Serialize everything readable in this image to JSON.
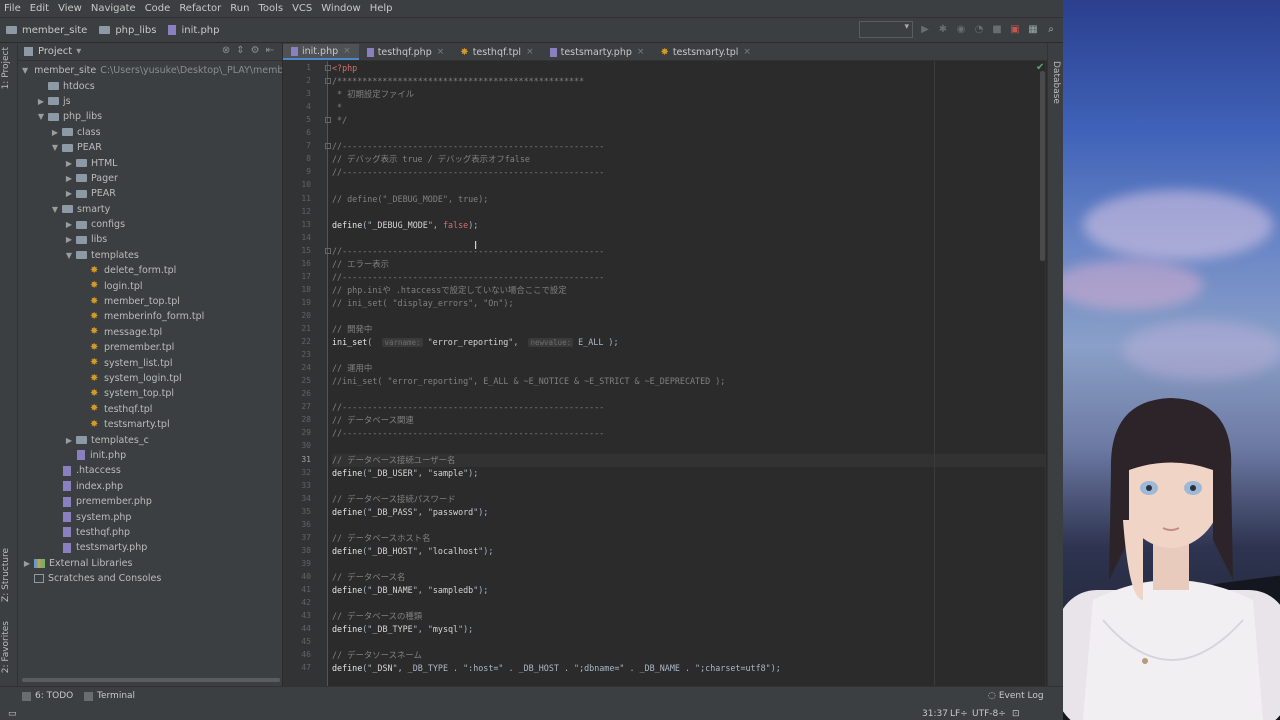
{
  "menu": [
    "File",
    "Edit",
    "View",
    "Navigate",
    "Code",
    "Refactor",
    "Run",
    "Tools",
    "VCS",
    "Window",
    "Help"
  ],
  "breadcrumbs": [
    "member_site",
    "php_libs",
    "init.php"
  ],
  "left_strip": {
    "project": "1: Project",
    "structure": "Z: Structure",
    "favorites": "2: Favorites"
  },
  "right_strip": {
    "database": "Database"
  },
  "project_panel": {
    "title": "Project",
    "root_path": "C:\\Users\\yusuke\\Desktop\\_PLAY\\member_s",
    "tree": [
      {
        "label": "member_site",
        "depth": 0,
        "type": "folder",
        "open": true
      },
      {
        "label": "htdocs",
        "depth": 1,
        "type": "folder",
        "open": false,
        "noarrow": true
      },
      {
        "label": "js",
        "depth": 1,
        "type": "folder",
        "open": false
      },
      {
        "label": "php_libs",
        "depth": 1,
        "type": "folder",
        "open": true
      },
      {
        "label": "class",
        "depth": 2,
        "type": "folder",
        "open": false
      },
      {
        "label": "PEAR",
        "depth": 2,
        "type": "folder",
        "open": true
      },
      {
        "label": "HTML",
        "depth": 3,
        "type": "folder",
        "open": false
      },
      {
        "label": "Pager",
        "depth": 3,
        "type": "folder",
        "open": false
      },
      {
        "label": "PEAR",
        "depth": 3,
        "type": "folder",
        "open": false
      },
      {
        "label": "smarty",
        "depth": 2,
        "type": "folder",
        "open": true
      },
      {
        "label": "configs",
        "depth": 3,
        "type": "folder",
        "open": false
      },
      {
        "label": "libs",
        "depth": 3,
        "type": "folder",
        "open": false
      },
      {
        "label": "templates",
        "depth": 3,
        "type": "folder",
        "open": true
      },
      {
        "label": "delete_form.tpl",
        "depth": 4,
        "type": "tpl"
      },
      {
        "label": "login.tpl",
        "depth": 4,
        "type": "tpl"
      },
      {
        "label": "member_top.tpl",
        "depth": 4,
        "type": "tpl"
      },
      {
        "label": "memberinfo_form.tpl",
        "depth": 4,
        "type": "tpl"
      },
      {
        "label": "message.tpl",
        "depth": 4,
        "type": "tpl"
      },
      {
        "label": "premember.tpl",
        "depth": 4,
        "type": "tpl"
      },
      {
        "label": "system_list.tpl",
        "depth": 4,
        "type": "tpl"
      },
      {
        "label": "system_login.tpl",
        "depth": 4,
        "type": "tpl"
      },
      {
        "label": "system_top.tpl",
        "depth": 4,
        "type": "tpl"
      },
      {
        "label": "testhqf.tpl",
        "depth": 4,
        "type": "tpl"
      },
      {
        "label": "testsmarty.tpl",
        "depth": 4,
        "type": "tpl"
      },
      {
        "label": "templates_c",
        "depth": 3,
        "type": "folder",
        "open": false
      },
      {
        "label": "init.php",
        "depth": 3,
        "type": "php"
      },
      {
        "label": ".htaccess",
        "depth": 2,
        "type": "php"
      },
      {
        "label": "index.php",
        "depth": 2,
        "type": "php"
      },
      {
        "label": "premember.php",
        "depth": 2,
        "type": "php"
      },
      {
        "label": "system.php",
        "depth": 2,
        "type": "php"
      },
      {
        "label": "testhqf.php",
        "depth": 2,
        "type": "php"
      },
      {
        "label": "testsmarty.php",
        "depth": 2,
        "type": "php"
      },
      {
        "label": "External Libraries",
        "depth": 0,
        "type": "lib"
      },
      {
        "label": "Scratches and Consoles",
        "depth": 0,
        "type": "cons"
      }
    ]
  },
  "tabs": [
    {
      "label": "init.php",
      "kind": "php",
      "active": true
    },
    {
      "label": "testhqf.php",
      "kind": "php",
      "active": false
    },
    {
      "label": "testhqf.tpl",
      "kind": "tpl",
      "active": false
    },
    {
      "label": "testsmarty.php",
      "kind": "php",
      "active": false
    },
    {
      "label": "testsmarty.tpl",
      "kind": "tpl",
      "active": false
    }
  ],
  "editor": {
    "current_line": 31,
    "lines": [
      {
        "n": 1,
        "segs": [
          [
            "ff",
            "<?php"
          ]
        ]
      },
      {
        "n": 2,
        "segs": [
          [
            "cmt",
            "/*************************************************"
          ]
        ]
      },
      {
        "n": 3,
        "segs": [
          [
            "cmt",
            " * 初期設定ファイル"
          ]
        ]
      },
      {
        "n": 4,
        "segs": [
          [
            "cmt",
            " *"
          ]
        ]
      },
      {
        "n": 5,
        "segs": [
          [
            "cmt",
            " */"
          ]
        ]
      },
      {
        "n": 6,
        "segs": []
      },
      {
        "n": 7,
        "segs": [
          [
            "cmt",
            "//----------------------------------------------------"
          ]
        ]
      },
      {
        "n": 8,
        "segs": [
          [
            "cmt",
            "// デバッグ表示 true / デバッグ表示オフfalse"
          ]
        ]
      },
      {
        "n": 9,
        "segs": [
          [
            "cmt",
            "//----------------------------------------------------"
          ]
        ]
      },
      {
        "n": 10,
        "segs": []
      },
      {
        "n": 11,
        "segs": [
          [
            "cmt",
            "// define(\"_DEBUG_MODE\", true);"
          ]
        ]
      },
      {
        "n": 12,
        "segs": []
      },
      {
        "n": 13,
        "segs": [
          [
            "fn",
            "define"
          ],
          [
            "",
            "(\""
          ],
          [
            "str",
            "_DEBUG_MODE"
          ],
          [
            "",
            "\", "
          ],
          [
            "ff",
            "false"
          ],
          [
            "",
            ");"
          ]
        ]
      },
      {
        "n": 14,
        "segs": []
      },
      {
        "n": 15,
        "segs": [
          [
            "cmt",
            "//----------------------------------------------------"
          ]
        ]
      },
      {
        "n": 16,
        "segs": [
          [
            "cmt",
            "// エラー表示"
          ]
        ]
      },
      {
        "n": 17,
        "segs": [
          [
            "cmt",
            "//----------------------------------------------------"
          ]
        ]
      },
      {
        "n": 18,
        "segs": [
          [
            "cmt",
            "// php.iniや .htaccessで設定していない場合ここで設定"
          ]
        ]
      },
      {
        "n": 19,
        "segs": [
          [
            "cmt",
            "// ini_set( \"display_errors\", \"On\");"
          ]
        ]
      },
      {
        "n": 20,
        "segs": []
      },
      {
        "n": 21,
        "segs": [
          [
            "cmt",
            "// 開発中"
          ]
        ]
      },
      {
        "n": 22,
        "segs": [
          [
            "fn",
            "ini_set"
          ],
          [
            "",
            "(  "
          ],
          [
            "hint",
            "varname:"
          ],
          [
            "",
            " \""
          ],
          [
            "str",
            "error_reporting"
          ],
          [
            "",
            "\",  "
          ],
          [
            "hint",
            "newvalue:"
          ],
          [
            "",
            " E_ALL );"
          ]
        ]
      },
      {
        "n": 23,
        "segs": []
      },
      {
        "n": 24,
        "segs": [
          [
            "cmt",
            "// 運用中"
          ]
        ]
      },
      {
        "n": 25,
        "segs": [
          [
            "cmt",
            "//ini_set( \"error_reporting\", E_ALL & ~E_NOTICE & ~E_STRICT & ~E_DEPRECATED );"
          ]
        ]
      },
      {
        "n": 26,
        "segs": []
      },
      {
        "n": 27,
        "segs": [
          [
            "cmt",
            "//----------------------------------------------------"
          ]
        ]
      },
      {
        "n": 28,
        "segs": [
          [
            "cmt",
            "// データベース関連"
          ]
        ]
      },
      {
        "n": 29,
        "segs": [
          [
            "cmt",
            "//----------------------------------------------------"
          ]
        ]
      },
      {
        "n": 30,
        "segs": []
      },
      {
        "n": 31,
        "segs": [
          [
            "cmt",
            "// データベース接続ユーザー名"
          ]
        ]
      },
      {
        "n": 32,
        "segs": [
          [
            "fn",
            "define"
          ],
          [
            "",
            "(\""
          ],
          [
            "str",
            "_DB_USER"
          ],
          [
            "",
            "\", \""
          ],
          [
            "str",
            "sample"
          ],
          [
            "",
            "\");"
          ]
        ]
      },
      {
        "n": 33,
        "segs": []
      },
      {
        "n": 34,
        "segs": [
          [
            "cmt",
            "// データベース接続パスワード"
          ]
        ]
      },
      {
        "n": 35,
        "segs": [
          [
            "fn",
            "define"
          ],
          [
            "",
            "(\""
          ],
          [
            "str",
            "_DB_PASS"
          ],
          [
            "",
            "\", \""
          ],
          [
            "str",
            "password"
          ],
          [
            "",
            "\");"
          ]
        ]
      },
      {
        "n": 36,
        "segs": []
      },
      {
        "n": 37,
        "segs": [
          [
            "cmt",
            "// データベースホスト名"
          ]
        ]
      },
      {
        "n": 38,
        "segs": [
          [
            "fn",
            "define"
          ],
          [
            "",
            "(\""
          ],
          [
            "str",
            "_DB_HOST"
          ],
          [
            "",
            "\", \""
          ],
          [
            "str",
            "localhost"
          ],
          [
            "",
            "\");"
          ]
        ]
      },
      {
        "n": 39,
        "segs": []
      },
      {
        "n": 40,
        "segs": [
          [
            "cmt",
            "// データベース名"
          ]
        ]
      },
      {
        "n": 41,
        "segs": [
          [
            "fn",
            "define"
          ],
          [
            "",
            "(\""
          ],
          [
            "str",
            "_DB_NAME"
          ],
          [
            "",
            "\", \""
          ],
          [
            "str",
            "sampledb"
          ],
          [
            "",
            "\");"
          ]
        ]
      },
      {
        "n": 42,
        "segs": []
      },
      {
        "n": 43,
        "segs": [
          [
            "cmt",
            "// データベースの種類"
          ]
        ]
      },
      {
        "n": 44,
        "segs": [
          [
            "fn",
            "define"
          ],
          [
            "",
            "(\""
          ],
          [
            "str",
            "_DB_TYPE"
          ],
          [
            "",
            "\", \""
          ],
          [
            "str",
            "mysql"
          ],
          [
            "",
            "\");"
          ]
        ]
      },
      {
        "n": 45,
        "segs": []
      },
      {
        "n": 46,
        "segs": [
          [
            "cmt",
            "// データソースネーム"
          ]
        ]
      },
      {
        "n": 47,
        "segs": [
          [
            "fn",
            "define"
          ],
          [
            "",
            "(\""
          ],
          [
            "str",
            "_DSN"
          ],
          [
            "",
            "\", _DB_TYPE . \":host=\" . _DB_HOST . \";dbname=\" . _DB_NAME . \";charset=utf8\");"
          ]
        ]
      }
    ]
  },
  "statusbar": {
    "todo": "6: TODO",
    "terminal": "Terminal",
    "event_log": "Event Log",
    "position": "31:37",
    "line_sep": "LF÷",
    "encoding": "UTF-8÷"
  }
}
